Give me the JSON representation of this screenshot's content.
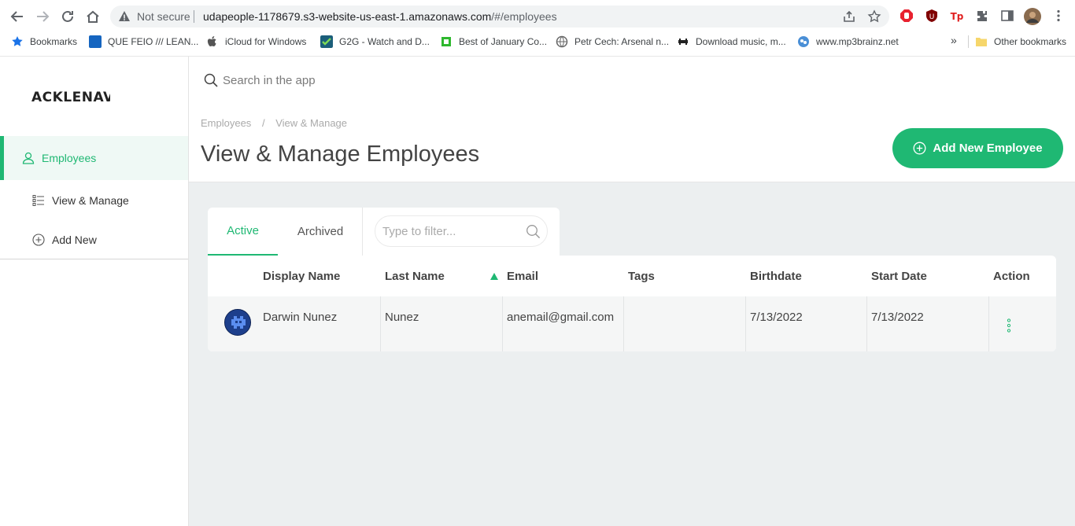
{
  "browser": {
    "not_secure": "Not secure",
    "url_host": "udapeople-1178679.s3-website-us-east-1.amazonaws.com",
    "url_path": "/#/employees",
    "bookmarks": [
      {
        "label": "Bookmarks",
        "color": "#1a73e8"
      },
      {
        "label": "QUE FEIO /// LEAN...",
        "color": "#1565c0"
      },
      {
        "label": "iCloud for Windows",
        "color": "#555555"
      },
      {
        "label": "G2G - Watch and D...",
        "color": "#1b8a3a"
      },
      {
        "label": "Best of January Co...",
        "color": "#2eb82e"
      },
      {
        "label": "Petr Cech: Arsenal n...",
        "color": "#666666"
      },
      {
        "label": "Download music, m...",
        "color": "#222222"
      },
      {
        "label": "www.mp3brainz.net",
        "color": "#4a8fd6"
      }
    ],
    "more_glyph": "»",
    "other_bookmarks": "Other bookmarks"
  },
  "sidebar": {
    "logo": "ACKLENAVENUE",
    "items": [
      {
        "label": "Employees",
        "icon": "user-icon",
        "active": true
      },
      {
        "label": "View & Manage",
        "icon": "list-icon",
        "active": false
      },
      {
        "label": "Add New",
        "icon": "plus-circle-icon",
        "active": false
      }
    ]
  },
  "search": {
    "placeholder": "Search in the app"
  },
  "breadcrumb": {
    "items": [
      "Employees",
      "/",
      "View & Manage"
    ]
  },
  "page_title": "View & Manage Employees",
  "add_button": {
    "label": "Add New Employee"
  },
  "tabs": [
    {
      "label": "Active",
      "active": true
    },
    {
      "label": "Archived",
      "active": false
    }
  ],
  "filter": {
    "placeholder": "Type to filter..."
  },
  "table": {
    "columns": [
      "Display Name",
      "Last Name",
      "Email",
      "Tags",
      "Birthdate",
      "Start Date",
      "Action"
    ],
    "sorted_column": "Email",
    "rows": [
      {
        "display_name": "Darwin Nunez",
        "last_name": "Nunez",
        "email": "anemail@gmail.com",
        "tags": "",
        "birthdate": "7/13/2022",
        "start_date": "7/13/2022"
      }
    ]
  },
  "colors": {
    "accent": "#1fb873",
    "content_bg": "#eceff0"
  }
}
